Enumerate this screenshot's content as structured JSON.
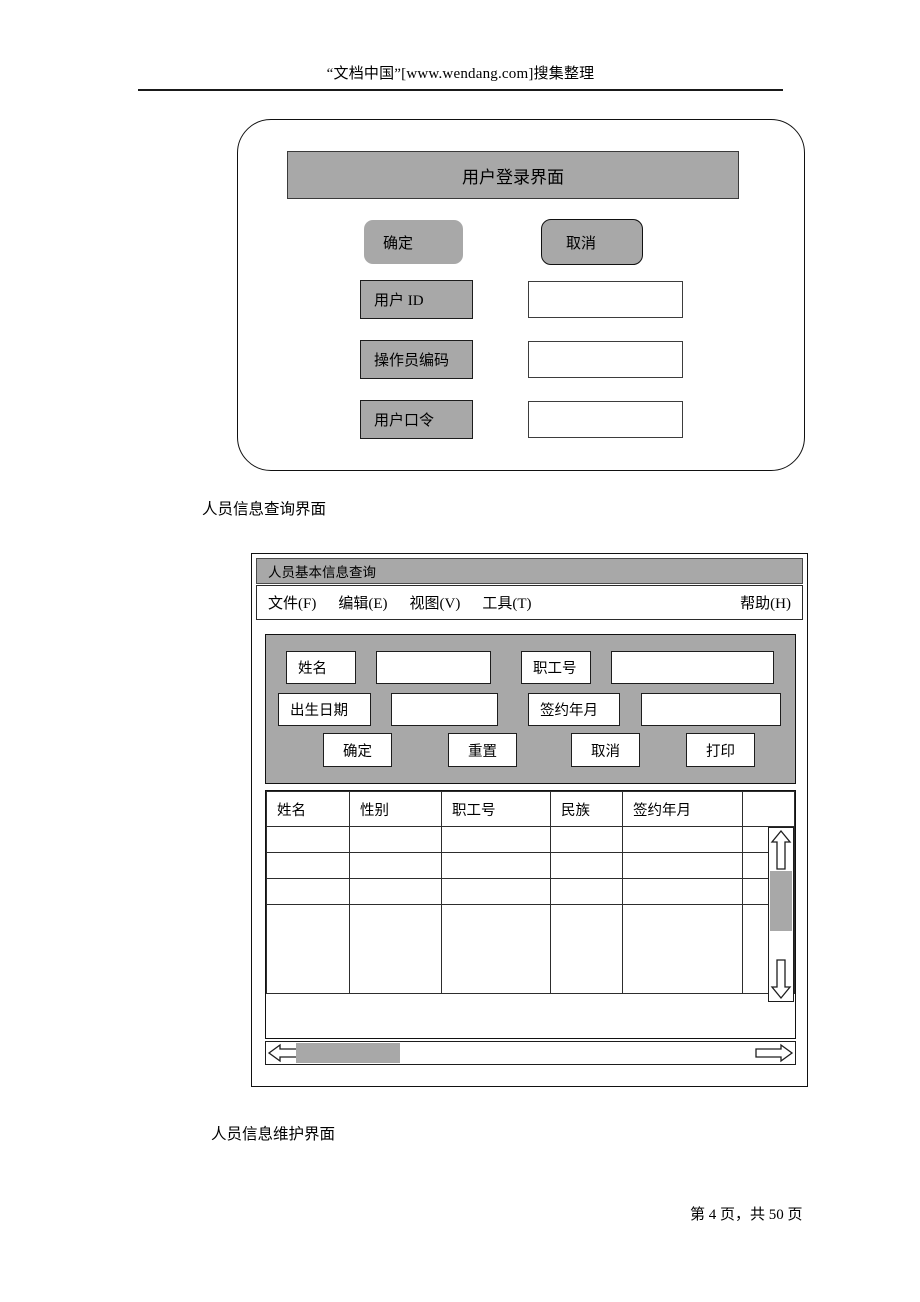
{
  "page": {
    "header_text": "“文档中国”[www.wendang.com]搜集整理",
    "footer_text": "第 4 页，共 50 页"
  },
  "login_mockup": {
    "title": "用户登录界面",
    "ok_button": "确定",
    "cancel_button": "取消",
    "fields": [
      {
        "label": "用户 ID",
        "value": ""
      },
      {
        "label": "操作员编码",
        "value": ""
      },
      {
        "label": "用户口令",
        "value": ""
      }
    ]
  },
  "captions": {
    "query": "人员信息查询界面",
    "maintenance": "人员信息维护界面"
  },
  "query_window": {
    "titlebar": "人员基本信息查询",
    "menu": {
      "left": [
        "文件(F)",
        "编辑(E)",
        "视图(V)",
        "工具(T)"
      ],
      "right": "帮助(H)"
    },
    "form_fields": [
      {
        "label": "姓名",
        "value": ""
      },
      {
        "label": "职工号",
        "value": ""
      },
      {
        "label": "出生日期",
        "value": ""
      },
      {
        "label": "签约年月",
        "value": ""
      }
    ],
    "buttons": [
      "确定",
      "重置",
      "取消",
      "打印"
    ],
    "table": {
      "columns": [
        "姓名",
        "性别",
        "职工号",
        "民族",
        "签约年月",
        ""
      ],
      "rows": [
        [
          "",
          "",
          "",
          "",
          "",
          ""
        ],
        [
          "",
          "",
          "",
          "",
          "",
          ""
        ],
        [
          "",
          "",
          "",
          "",
          "",
          ""
        ]
      ]
    }
  },
  "colors": {
    "gray_fill": "#a8a8a8",
    "outline": "#111111",
    "paper": "#ffffff"
  }
}
